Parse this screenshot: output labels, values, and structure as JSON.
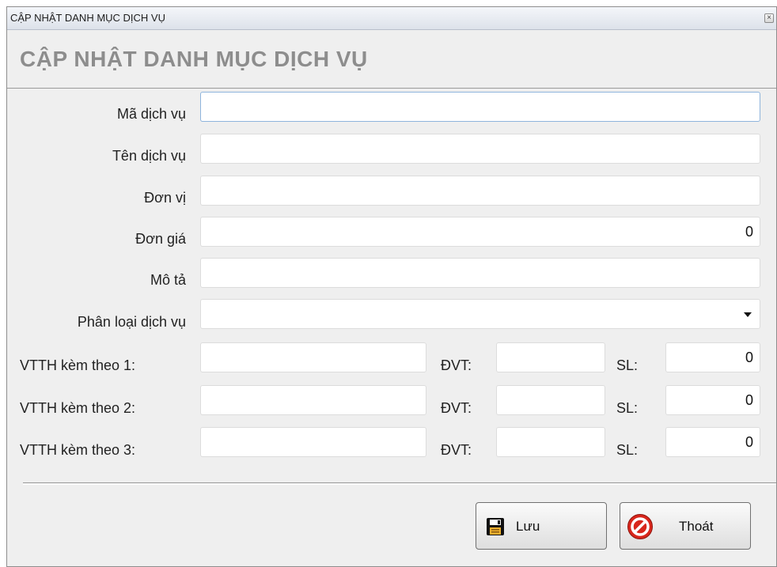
{
  "window": {
    "title": "CẬP NHẬT DANH MỤC DỊCH VỤ",
    "close_glyph": "×"
  },
  "header": {
    "title": "CẬP NHẬT DANH MỤC DỊCH VỤ"
  },
  "form": {
    "ma_dich_vu": {
      "label": "Mã dịch vụ",
      "value": ""
    },
    "ten_dich_vu": {
      "label": "Tên dịch vụ",
      "value": ""
    },
    "don_vi": {
      "label": "Đơn vị",
      "value": ""
    },
    "don_gia": {
      "label": "Đơn giá",
      "value": "0"
    },
    "mo_ta": {
      "label": "Mô tả",
      "value": ""
    },
    "phan_loai": {
      "label": "Phân loại dịch vụ",
      "value": ""
    },
    "vtth": [
      {
        "label": "VTTH kèm theo 1:",
        "name_value": "",
        "dvt_label": "ĐVT:",
        "dvt_value": "",
        "sl_label": "SL:",
        "sl_value": "0"
      },
      {
        "label": "VTTH kèm theo 2:",
        "name_value": "",
        "dvt_label": "ĐVT:",
        "dvt_value": "",
        "sl_label": "SL:",
        "sl_value": "0"
      },
      {
        "label": "VTTH kèm theo 3:",
        "name_value": "",
        "dvt_label": "ĐVT:",
        "dvt_value": "",
        "sl_label": "SL:",
        "sl_value": "0"
      }
    ]
  },
  "buttons": {
    "save": {
      "label": "Lưu",
      "icon": "floppy-disk-icon"
    },
    "exit": {
      "label": "Thoát",
      "icon": "no-entry-icon"
    }
  },
  "colors": {
    "header_title": "#8d8d8d",
    "exit_icon": "#d8261c",
    "focus_border": "#8fb4dc"
  }
}
